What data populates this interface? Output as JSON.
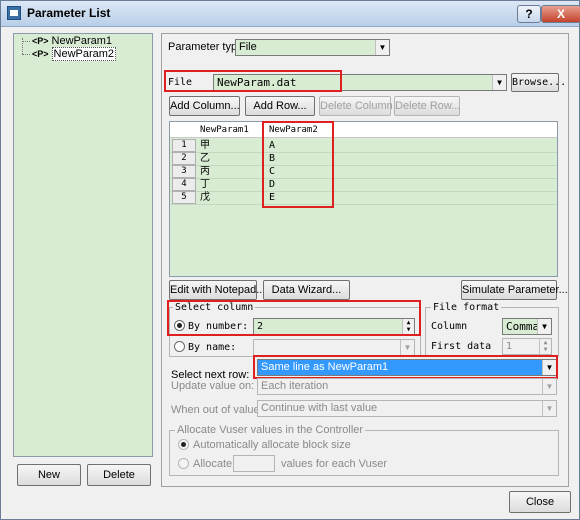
{
  "window": {
    "title": "Parameter List",
    "help_label": "?",
    "close_label": "X"
  },
  "tree": {
    "items": [
      "NewParam1",
      "NewParam2"
    ]
  },
  "left_buttons": {
    "new": "New",
    "delete": "Delete"
  },
  "param_type": {
    "label": "Parameter type:",
    "value": "File"
  },
  "file": {
    "label": "File",
    "value": "NewParam.dat",
    "browse": "Browse..."
  },
  "actions": {
    "add_column": "Add Column...",
    "add_row": "Add Row...",
    "delete_column": "Delete Column...",
    "delete_row": "Delete Row..."
  },
  "grid": {
    "columns": [
      "NewParam1",
      "NewParam2"
    ],
    "rows": [
      {
        "num": "1",
        "c1": "甲",
        "c2": "A"
      },
      {
        "num": "2",
        "c1": "乙",
        "c2": "B"
      },
      {
        "num": "3",
        "c1": "丙",
        "c2": "C"
      },
      {
        "num": "4",
        "c1": "丁",
        "c2": "D"
      },
      {
        "num": "5",
        "c1": "戊",
        "c2": "E"
      }
    ]
  },
  "mid_buttons": {
    "notepad": "Edit with Notepad...",
    "wizard": "Data Wizard...",
    "simulate": "Simulate Parameter..."
  },
  "select_column": {
    "title": "Select column",
    "by_number": "By number:",
    "number_value": "2",
    "by_name": "By name:"
  },
  "file_format": {
    "title": "File format",
    "column_label": "Column",
    "column_value": "Comma",
    "first_data_label": "First data",
    "first_data_value": "1"
  },
  "next_row": {
    "label": "Select next row:",
    "value": "Same line as NewParam1"
  },
  "update": {
    "label": "Update value on:",
    "value": "Each iteration"
  },
  "out_of_values": {
    "label": "When out of values:",
    "value": "Continue with last value"
  },
  "allocate": {
    "title": "Allocate Vuser values in the Controller",
    "auto": "Automatically allocate block size",
    "manual": "Allocate",
    "manual_suffix": "values for each Vuser"
  },
  "close_button": "Close"
}
